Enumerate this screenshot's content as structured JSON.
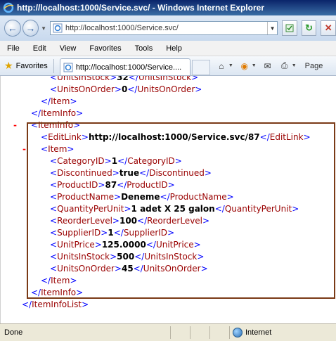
{
  "window": {
    "title": "http://localhost:1000/Service.svc/ - Windows Internet Explorer"
  },
  "address": {
    "url": "http://localhost:1000/Service.svc/"
  },
  "menu": [
    "File",
    "Edit",
    "View",
    "Favorites",
    "Tools",
    "Help"
  ],
  "toolbar": {
    "favorites_label": "Favorites",
    "tab_label": "http://localhost:1000/Service....",
    "page_label": "Page"
  },
  "xml": {
    "lines": [
      {
        "indent": "l1",
        "parts": [
          [
            "t",
            "<"
          ],
          [
            "tag",
            "UnitsInStock"
          ],
          [
            "t",
            ">"
          ],
          [
            "val",
            "32"
          ],
          [
            "t",
            "</"
          ],
          [
            "tag",
            "UnitsInStock"
          ],
          [
            "t",
            ">"
          ]
        ]
      },
      {
        "indent": "l1",
        "parts": [
          [
            "t",
            "<"
          ],
          [
            "tag",
            "UnitsOnOrder"
          ],
          [
            "t",
            ">"
          ],
          [
            "val",
            "0"
          ],
          [
            "t",
            "</"
          ],
          [
            "tag",
            "UnitsOnOrder"
          ],
          [
            "t",
            ">"
          ]
        ]
      },
      {
        "indent": "l0",
        "parts": [
          [
            "t",
            "</"
          ],
          [
            "tag",
            "Item"
          ],
          [
            "t",
            ">"
          ]
        ]
      },
      {
        "indent": "lm1",
        "parts": [
          [
            "t",
            "</"
          ],
          [
            "tag",
            "ItemInfo"
          ],
          [
            "t",
            ">"
          ]
        ]
      },
      {
        "indent": "lm1",
        "minus": true,
        "parts": [
          [
            "t",
            "<"
          ],
          [
            "tag",
            "ItemInfo"
          ],
          [
            "t",
            ">"
          ]
        ]
      },
      {
        "indent": "l0",
        "parts": [
          [
            "t",
            "<"
          ],
          [
            "tag",
            "EditLink"
          ],
          [
            "t",
            ">"
          ],
          [
            "val",
            "http://localhost:1000/Service.svc/87"
          ],
          [
            "t",
            "</"
          ],
          [
            "tag",
            "EditLink"
          ],
          [
            "t",
            ">"
          ]
        ]
      },
      {
        "indent": "l0",
        "minus": true,
        "parts": [
          [
            "t",
            "<"
          ],
          [
            "tag",
            "Item"
          ],
          [
            "t",
            ">"
          ]
        ]
      },
      {
        "indent": "l1",
        "parts": [
          [
            "t",
            "<"
          ],
          [
            "tag",
            "CategoryID"
          ],
          [
            "t",
            ">"
          ],
          [
            "val",
            "1"
          ],
          [
            "t",
            "</"
          ],
          [
            "tag",
            "CategoryID"
          ],
          [
            "t",
            ">"
          ]
        ]
      },
      {
        "indent": "l1",
        "parts": [
          [
            "t",
            "<"
          ],
          [
            "tag",
            "Discontinued"
          ],
          [
            "t",
            ">"
          ],
          [
            "val",
            "true"
          ],
          [
            "t",
            "</"
          ],
          [
            "tag",
            "Discontinued"
          ],
          [
            "t",
            ">"
          ]
        ]
      },
      {
        "indent": "l1",
        "parts": [
          [
            "t",
            "<"
          ],
          [
            "tag",
            "ProductID"
          ],
          [
            "t",
            ">"
          ],
          [
            "val",
            "87"
          ],
          [
            "t",
            "</"
          ],
          [
            "tag",
            "ProductID"
          ],
          [
            "t",
            ">"
          ]
        ]
      },
      {
        "indent": "l1",
        "parts": [
          [
            "t",
            "<"
          ],
          [
            "tag",
            "ProductName"
          ],
          [
            "t",
            ">"
          ],
          [
            "val",
            "Deneme"
          ],
          [
            "t",
            "</"
          ],
          [
            "tag",
            "ProductName"
          ],
          [
            "t",
            ">"
          ]
        ]
      },
      {
        "indent": "l1",
        "parts": [
          [
            "t",
            "<"
          ],
          [
            "tag",
            "QuantityPerUnit"
          ],
          [
            "t",
            ">"
          ],
          [
            "val",
            "1 adet X 25 galon"
          ],
          [
            "t",
            "</"
          ],
          [
            "tag",
            "QuantityPerUnit"
          ],
          [
            "t",
            ">"
          ]
        ]
      },
      {
        "indent": "l1",
        "parts": [
          [
            "t",
            "<"
          ],
          [
            "tag",
            "ReorderLevel"
          ],
          [
            "t",
            ">"
          ],
          [
            "val",
            "100"
          ],
          [
            "t",
            "</"
          ],
          [
            "tag",
            "ReorderLevel"
          ],
          [
            "t",
            ">"
          ]
        ]
      },
      {
        "indent": "l1",
        "parts": [
          [
            "t",
            "<"
          ],
          [
            "tag",
            "SupplierID"
          ],
          [
            "t",
            ">"
          ],
          [
            "val",
            "1"
          ],
          [
            "t",
            "</"
          ],
          [
            "tag",
            "SupplierID"
          ],
          [
            "t",
            ">"
          ]
        ]
      },
      {
        "indent": "l1",
        "parts": [
          [
            "t",
            "<"
          ],
          [
            "tag",
            "UnitPrice"
          ],
          [
            "t",
            ">"
          ],
          [
            "val",
            "125.0000"
          ],
          [
            "t",
            "</"
          ],
          [
            "tag",
            "UnitPrice"
          ],
          [
            "t",
            ">"
          ]
        ]
      },
      {
        "indent": "l1",
        "parts": [
          [
            "t",
            "<"
          ],
          [
            "tag",
            "UnitsInStock"
          ],
          [
            "t",
            ">"
          ],
          [
            "val",
            "500"
          ],
          [
            "t",
            "</"
          ],
          [
            "tag",
            "UnitsInStock"
          ],
          [
            "t",
            ">"
          ]
        ]
      },
      {
        "indent": "l1",
        "parts": [
          [
            "t",
            "<"
          ],
          [
            "tag",
            "UnitsOnOrder"
          ],
          [
            "t",
            ">"
          ],
          [
            "val",
            "45"
          ],
          [
            "t",
            "</"
          ],
          [
            "tag",
            "UnitsOnOrder"
          ],
          [
            "t",
            ">"
          ]
        ]
      },
      {
        "indent": "l0",
        "parts": [
          [
            "t",
            "</"
          ],
          [
            "tag",
            "Item"
          ],
          [
            "t",
            ">"
          ]
        ]
      },
      {
        "indent": "lm1",
        "parts": [
          [
            "t",
            "</"
          ],
          [
            "tag",
            "ItemInfo"
          ],
          [
            "t",
            ">"
          ]
        ]
      },
      {
        "indent": "lm2",
        "parts": [
          [
            "t",
            "</"
          ],
          [
            "tag",
            "ItemInfoList"
          ],
          [
            "t",
            ">"
          ]
        ]
      }
    ]
  },
  "status": {
    "text": "Done",
    "zone": "Internet"
  },
  "colors": {
    "markup": "#0000ff",
    "tag_name": "#990000",
    "collapse_minus": "#ff0000",
    "highlight_border": "#7a3a16"
  }
}
